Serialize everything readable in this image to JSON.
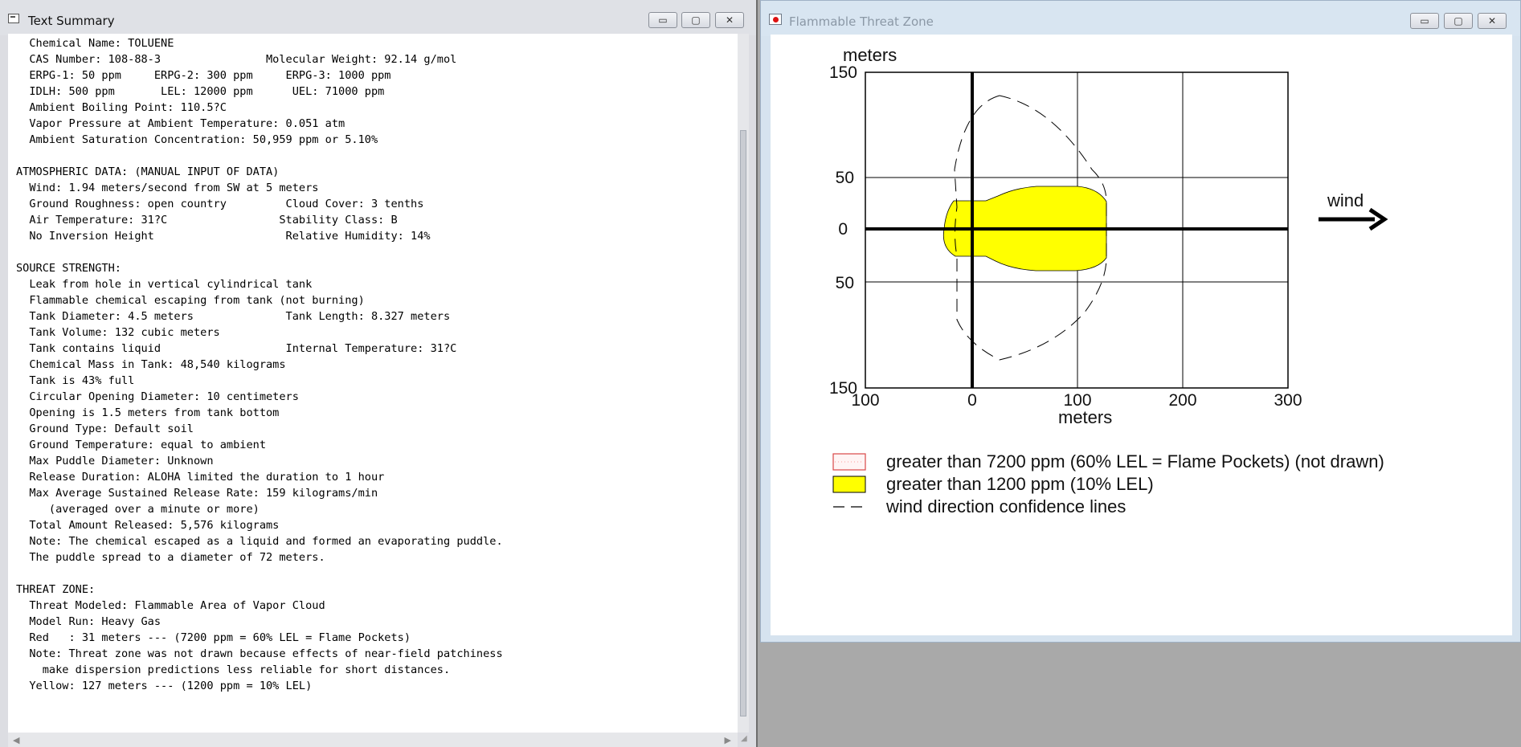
{
  "left_window": {
    "title": "Text Summary",
    "buttons": [
      "▭",
      "▢",
      "✕"
    ],
    "text_lines": [
      "  Chemical Name: TOLUENE",
      "  CAS Number: 108-88-3                Molecular Weight: 92.14 g/mol",
      "  ERPG-1: 50 ppm     ERPG-2: 300 ppm     ERPG-3: 1000 ppm",
      "  IDLH: 500 ppm       LEL: 12000 ppm      UEL: 71000 ppm",
      "  Ambient Boiling Point: 110.5?C",
      "  Vapor Pressure at Ambient Temperature: 0.051 atm",
      "  Ambient Saturation Concentration: 50,959 ppm or 5.10%",
      "",
      "ATMOSPHERIC DATA: (MANUAL INPUT OF DATA)",
      "  Wind: 1.94 meters/second from SW at 5 meters",
      "  Ground Roughness: open country         Cloud Cover: 3 tenths",
      "  Air Temperature: 31?C                 Stability Class: B",
      "  No Inversion Height                    Relative Humidity: 14%",
      "",
      "SOURCE STRENGTH:",
      "  Leak from hole in vertical cylindrical tank",
      "  Flammable chemical escaping from tank (not burning)",
      "  Tank Diameter: 4.5 meters              Tank Length: 8.327 meters",
      "  Tank Volume: 132 cubic meters",
      "  Tank contains liquid                   Internal Temperature: 31?C",
      "  Chemical Mass in Tank: 48,540 kilograms",
      "  Tank is 43% full",
      "  Circular Opening Diameter: 10 centimeters",
      "  Opening is 1.5 meters from tank bottom",
      "  Ground Type: Default soil",
      "  Ground Temperature: equal to ambient",
      "  Max Puddle Diameter: Unknown",
      "  Release Duration: ALOHA limited the duration to 1 hour",
      "  Max Average Sustained Release Rate: 159 kilograms/min",
      "     (averaged over a minute or more)",
      "  Total Amount Released: 5,576 kilograms",
      "  Note: The chemical escaped as a liquid and formed an evaporating puddle.",
      "  The puddle spread to a diameter of 72 meters.",
      "",
      "THREAT ZONE:",
      "  Threat Modeled: Flammable Area of Vapor Cloud",
      "  Model Run: Heavy Gas",
      "  Red   : 31 meters --- (7200 ppm = 60% LEL = Flame Pockets)",
      "  Note: Threat zone was not drawn because effects of near-field patchiness",
      "    make dispersion predictions less reliable for short distances.",
      "  Yellow: 127 meters --- (1200 ppm = 10% LEL)"
    ]
  },
  "right_window": {
    "title": "Flammable Threat Zone",
    "buttons": [
      "▭",
      "▢",
      "✕"
    ],
    "y_axis_label": "meters",
    "x_axis_label": "meters",
    "wind_label": "wind",
    "y_ticks": [
      "150",
      "50",
      "0",
      "50",
      "150"
    ],
    "x_ticks": [
      "100",
      "0",
      "100",
      "200",
      "300"
    ],
    "legend": [
      {
        "label": "greater than 7200 ppm (60% LEL = Flame Pockets) (not drawn)",
        "fill": "#ffb3b3"
      },
      {
        "label": "greater than 1200 ppm (10% LEL)",
        "fill": "#ffff00"
      },
      {
        "label": "wind direction confidence lines",
        "stroke": "#000000"
      }
    ],
    "colors": {
      "zone_yellow": "#ffff00",
      "axis": "#000000"
    }
  }
}
